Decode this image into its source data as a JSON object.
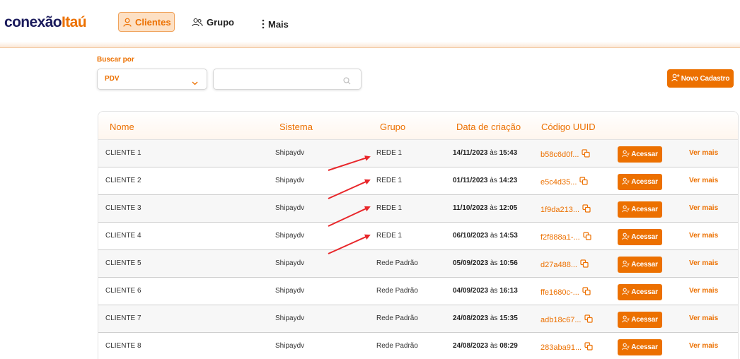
{
  "brand": {
    "part1": "conexão",
    "part2": "Itaú"
  },
  "nav": {
    "clientes": "Clientes",
    "grupo": "Grupo",
    "mais": "Mais"
  },
  "filters": {
    "label": "Buscar por",
    "select_value": "PDV",
    "search_placeholder": "",
    "search_value": ""
  },
  "new_button": "Novo Cadastro",
  "table": {
    "headers": {
      "nome": "Nome",
      "sistema": "Sistema",
      "grupo": "Grupo",
      "data": "Data de criação",
      "uuid": "Código UUID"
    },
    "access_label": "Acessar",
    "more_label": "Ver mais",
    "date_sep": "às",
    "rows": [
      {
        "nome": "CLIENTE 1",
        "sistema": "Shipaydv",
        "grupo": "REDE 1",
        "date": "14/11/2023",
        "time": "15:43",
        "uuid": "b58c6d0f..."
      },
      {
        "nome": "CLIENTE 2",
        "sistema": "Shipaydv",
        "grupo": "REDE 1",
        "date": "01/11/2023",
        "time": "14:23",
        "uuid": "e5c4d35..."
      },
      {
        "nome": "CLIENTE 3",
        "sistema": "Shipaydv",
        "grupo": "REDE 1",
        "date": "11/10/2023",
        "time": "12:05",
        "uuid": "1f9da213..."
      },
      {
        "nome": "CLIENTE 4",
        "sistema": "Shipaydv",
        "grupo": "REDE 1",
        "date": "06/10/2023",
        "time": "14:53",
        "uuid": "f2f888a1-..."
      },
      {
        "nome": "CLIENTE 5",
        "sistema": "Shipaydv",
        "grupo": "Rede Padrão",
        "date": "05/09/2023",
        "time": "10:56",
        "uuid": "d27a488..."
      },
      {
        "nome": "CLIENTE 6",
        "sistema": "Shipaydv",
        "grupo": "Rede Padrão",
        "date": "04/09/2023",
        "time": "16:13",
        "uuid": "ffe1680c-..."
      },
      {
        "nome": "CLIENTE 7",
        "sistema": "Shipaydv",
        "grupo": "Rede Padrão",
        "date": "24/08/2023",
        "time": "15:35",
        "uuid": "adb18c67..."
      },
      {
        "nome": "CLIENTE 8",
        "sistema": "Shipaydv",
        "grupo": "Rede Padrão",
        "date": "24/08/2023",
        "time": "08:29",
        "uuid": "283aba91..."
      }
    ]
  },
  "annotations": {
    "arrows_target_group": "REDE 1",
    "arrow_color": "#e8262a"
  },
  "colors": {
    "accent": "#ec7000",
    "brand_dark": "#1b1b5c",
    "active_nav_bg": "#fde0c4"
  }
}
